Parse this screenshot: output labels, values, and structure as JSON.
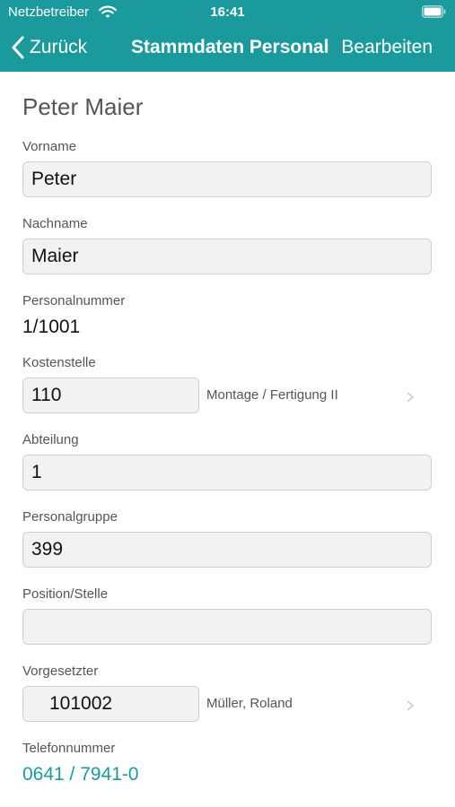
{
  "status_bar": {
    "carrier": "Netzbetreiber",
    "time": "16:41"
  },
  "nav": {
    "back_label": "Zurück",
    "title": "Stammdaten Personal",
    "edit_label": "Bearbeiten"
  },
  "colors": {
    "accent": "#1a9a9d"
  },
  "icons": {
    "wifi": "wifi-icon",
    "battery": "battery-icon",
    "back": "chevron-left-icon",
    "disclosure": "chevron-right-icon"
  },
  "person": {
    "full_name": "Peter Maier"
  },
  "fields": {
    "vorname": {
      "label": "Vorname",
      "value": "Peter"
    },
    "nachname": {
      "label": "Nachname",
      "value": "Maier"
    },
    "personalnummer": {
      "label": "Personalnummer",
      "value": "1/1001"
    },
    "kostenstelle": {
      "label": "Kostenstelle",
      "value": "110",
      "description": "Montage / Fertigung II"
    },
    "abteilung": {
      "label": "Abteilung",
      "value": "1"
    },
    "personalgruppe": {
      "label": "Personalgruppe",
      "value": "399"
    },
    "position": {
      "label": "Position/Stelle",
      "value": ""
    },
    "vorgesetzter": {
      "label": "Vorgesetzter",
      "value": "101002",
      "description": "Müller, Roland"
    },
    "telefonnummer": {
      "label": "Telefonnummer",
      "value": "0641 / 7941-0"
    }
  }
}
